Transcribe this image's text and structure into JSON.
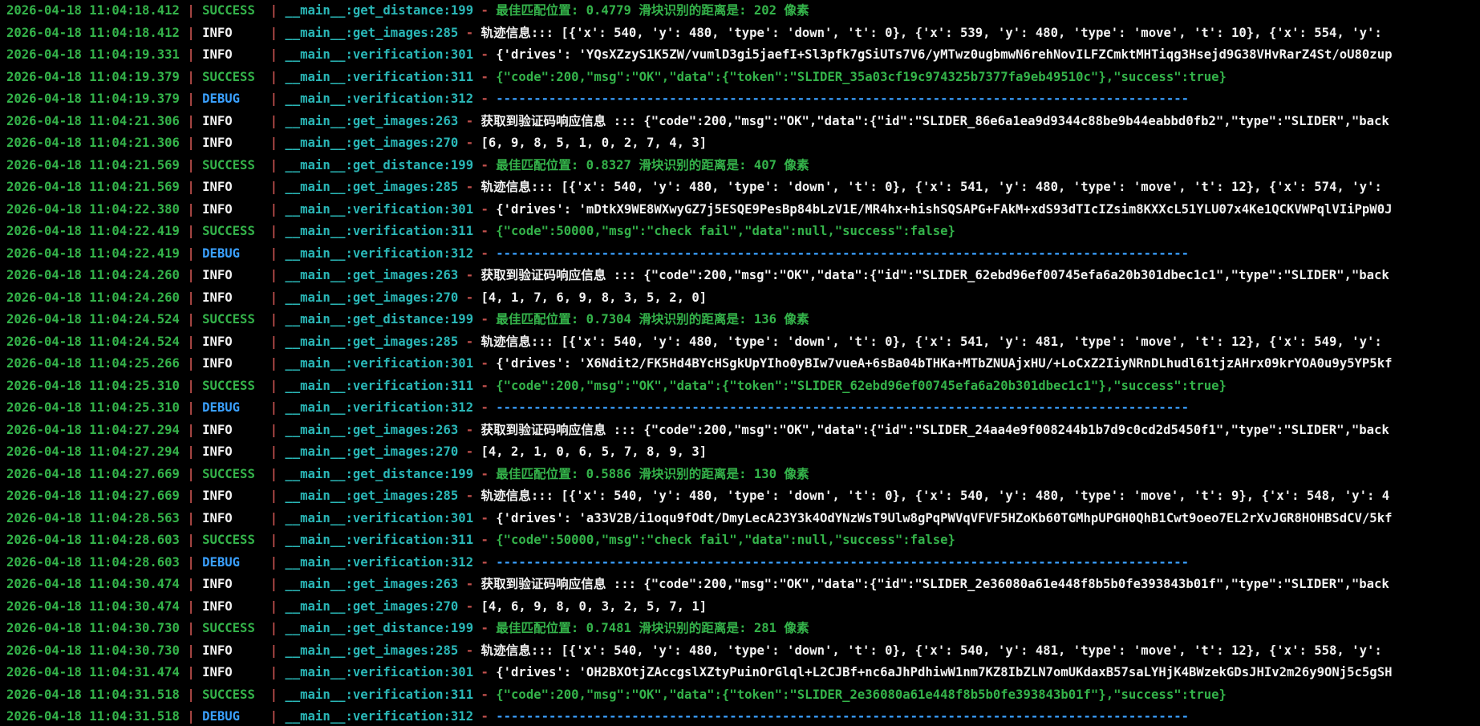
{
  "colors": {
    "background": "#000000",
    "timestamp": "#34b34a",
    "separator": "#c0504d",
    "info": "#f2f2f2",
    "success": "#34b34a",
    "debug": "#3aa0ff",
    "module": "#2ab7b7"
  },
  "log_lines": [
    {
      "time": "2026-04-18 11:04:18.412",
      "level": "SUCCESS",
      "location": "__main__:get_distance:199",
      "message": "最佳匹配位置: 0.4779 滑块识别的距离是: 202 像素"
    },
    {
      "time": "2026-04-18 11:04:18.412",
      "level": "INFO",
      "location": "__main__:get_images:285",
      "message": "轨迹信息::: [{'x': 540, 'y': 480, 'type': 'down', 't': 0}, {'x': 539, 'y': 480, 'type': 'move', 't': 10}, {'x': 554, 'y':"
    },
    {
      "time": "2026-04-18 11:04:19.331",
      "level": "INFO",
      "location": "__main__:verification:301",
      "message": "{'drives': 'YQsXZzyS1K5ZW/vumlD3gi5jaefI+Sl3pfk7gSiUTs7V6/yMTwz0ugbmwN6rehNovILFZCmktMHTiqg3Hsejd9G38VHvRarZ4St/oU80zup"
    },
    {
      "time": "2026-04-18 11:04:19.379",
      "level": "SUCCESS",
      "location": "__main__:verification:311",
      "message": "{\"code\":200,\"msg\":\"OK\",\"data\":{\"token\":\"SLIDER_35a03cf19c974325b7377fa9eb49510c\"},\"success\":true}"
    },
    {
      "time": "2026-04-18 11:04:19.379",
      "level": "DEBUG",
      "location": "__main__:verification:312",
      "message": "--------------------------------------------------------------------------------------------"
    },
    {
      "time": "2026-04-18 11:04:21.306",
      "level": "INFO",
      "location": "__main__:get_images:263",
      "message": "获取到验证码响应信息 ::: {\"code\":200,\"msg\":\"OK\",\"data\":{\"id\":\"SLIDER_86e6a1ea9d9344c88be9b44eabbd0fb2\",\"type\":\"SLIDER\",\"back"
    },
    {
      "time": "2026-04-18 11:04:21.306",
      "level": "INFO",
      "location": "__main__:get_images:270",
      "message": "[6, 9, 8, 5, 1, 0, 2, 7, 4, 3]"
    },
    {
      "time": "2026-04-18 11:04:21.569",
      "level": "SUCCESS",
      "location": "__main__:get_distance:199",
      "message": "最佳匹配位置: 0.8327 滑块识别的距离是: 407 像素"
    },
    {
      "time": "2026-04-18 11:04:21.569",
      "level": "INFO",
      "location": "__main__:get_images:285",
      "message": "轨迹信息::: [{'x': 540, 'y': 480, 'type': 'down', 't': 0}, {'x': 541, 'y': 480, 'type': 'move', 't': 12}, {'x': 574, 'y':"
    },
    {
      "time": "2026-04-18 11:04:22.380",
      "level": "INFO",
      "location": "__main__:verification:301",
      "message": "{'drives': 'mDtkX9WE8WXwyGZ7j5ESQE9PesBp84bLzV1E/MR4hx+hishSQSAPG+FAkM+xdS93dTIcIZsim8KXXcL51YLU07x4Ke1QCKVWPqlVIiPpW0J"
    },
    {
      "time": "2026-04-18 11:04:22.419",
      "level": "SUCCESS",
      "location": "__main__:verification:311",
      "message": "{\"code\":50000,\"msg\":\"check fail\",\"data\":null,\"success\":false}"
    },
    {
      "time": "2026-04-18 11:04:22.419",
      "level": "DEBUG",
      "location": "__main__:verification:312",
      "message": "--------------------------------------------------------------------------------------------"
    },
    {
      "time": "2026-04-18 11:04:24.260",
      "level": "INFO",
      "location": "__main__:get_images:263",
      "message": "获取到验证码响应信息 ::: {\"code\":200,\"msg\":\"OK\",\"data\":{\"id\":\"SLIDER_62ebd96ef00745efa6a20b301dbec1c1\",\"type\":\"SLIDER\",\"back"
    },
    {
      "time": "2026-04-18 11:04:24.260",
      "level": "INFO",
      "location": "__main__:get_images:270",
      "message": "[4, 1, 7, 6, 9, 8, 3, 5, 2, 0]"
    },
    {
      "time": "2026-04-18 11:04:24.524",
      "level": "SUCCESS",
      "location": "__main__:get_distance:199",
      "message": "最佳匹配位置: 0.7304 滑块识别的距离是: 136 像素"
    },
    {
      "time": "2026-04-18 11:04:24.524",
      "level": "INFO",
      "location": "__main__:get_images:285",
      "message": "轨迹信息::: [{'x': 540, 'y': 480, 'type': 'down', 't': 0}, {'x': 541, 'y': 481, 'type': 'move', 't': 12}, {'x': 549, 'y':"
    },
    {
      "time": "2026-04-18 11:04:25.266",
      "level": "INFO",
      "location": "__main__:verification:301",
      "message": "{'drives': 'X6Ndit2/FK5Hd4BYcHSgkUpYIho0yBIw7vueA+6sBa04bTHKa+MTbZNUAjxHU/+LoCxZ2IiyNRnDLhudl61tjzAHrx09krYOA0u9y5YP5kf"
    },
    {
      "time": "2026-04-18 11:04:25.310",
      "level": "SUCCESS",
      "location": "__main__:verification:311",
      "message": "{\"code\":200,\"msg\":\"OK\",\"data\":{\"token\":\"SLIDER_62ebd96ef00745efa6a20b301dbec1c1\"},\"success\":true}"
    },
    {
      "time": "2026-04-18 11:04:25.310",
      "level": "DEBUG",
      "location": "__main__:verification:312",
      "message": "--------------------------------------------------------------------------------------------"
    },
    {
      "time": "2026-04-18 11:04:27.294",
      "level": "INFO",
      "location": "__main__:get_images:263",
      "message": "获取到验证码响应信息 ::: {\"code\":200,\"msg\":\"OK\",\"data\":{\"id\":\"SLIDER_24aa4e9f008244b1b7d9c0cd2d5450f1\",\"type\":\"SLIDER\",\"back"
    },
    {
      "time": "2026-04-18 11:04:27.294",
      "level": "INFO",
      "location": "__main__:get_images:270",
      "message": "[4, 2, 1, 0, 6, 5, 7, 8, 9, 3]"
    },
    {
      "time": "2026-04-18 11:04:27.669",
      "level": "SUCCESS",
      "location": "__main__:get_distance:199",
      "message": "最佳匹配位置: 0.5886 滑块识别的距离是: 130 像素"
    },
    {
      "time": "2026-04-18 11:04:27.669",
      "level": "INFO",
      "location": "__main__:get_images:285",
      "message": "轨迹信息::: [{'x': 540, 'y': 480, 'type': 'down', 't': 0}, {'x': 540, 'y': 480, 'type': 'move', 't': 9}, {'x': 548, 'y': 4"
    },
    {
      "time": "2026-04-18 11:04:28.563",
      "level": "INFO",
      "location": "__main__:verification:301",
      "message": "{'drives': 'a33V2B/i1oqu9fOdt/DmyLecA23Y3k4OdYNzWsT9Ulw8gPqPWVqVFVF5HZoKb60TGMhpUPGH0QhB1Cwt9oeo7EL2rXvJGR8HOHBSdCV/5kf"
    },
    {
      "time": "2026-04-18 11:04:28.603",
      "level": "SUCCESS",
      "location": "__main__:verification:311",
      "message": "{\"code\":50000,\"msg\":\"check fail\",\"data\":null,\"success\":false}"
    },
    {
      "time": "2026-04-18 11:04:28.603",
      "level": "DEBUG",
      "location": "__main__:verification:312",
      "message": "--------------------------------------------------------------------------------------------"
    },
    {
      "time": "2026-04-18 11:04:30.474",
      "level": "INFO",
      "location": "__main__:get_images:263",
      "message": "获取到验证码响应信息 ::: {\"code\":200,\"msg\":\"OK\",\"data\":{\"id\":\"SLIDER_2e36080a61e448f8b5b0fe393843b01f\",\"type\":\"SLIDER\",\"back"
    },
    {
      "time": "2026-04-18 11:04:30.474",
      "level": "INFO",
      "location": "__main__:get_images:270",
      "message": "[4, 6, 9, 8, 0, 3, 2, 5, 7, 1]"
    },
    {
      "time": "2026-04-18 11:04:30.730",
      "level": "SUCCESS",
      "location": "__main__:get_distance:199",
      "message": "最佳匹配位置: 0.7481 滑块识别的距离是: 281 像素"
    },
    {
      "time": "2026-04-18 11:04:30.730",
      "level": "INFO",
      "location": "__main__:get_images:285",
      "message": "轨迹信息::: [{'x': 540, 'y': 480, 'type': 'down', 't': 0}, {'x': 540, 'y': 481, 'type': 'move', 't': 12}, {'x': 558, 'y':"
    },
    {
      "time": "2026-04-18 11:04:31.474",
      "level": "INFO",
      "location": "__main__:verification:301",
      "message": "{'drives': 'OH2BXOtjZAccgslXZtyPuinOrGlql+L2CJBf+nc6aJhPdhiwW1nm7KZ8IbZLN7omUKdaxB57saLYHjK4BWzekGDsJHIv2m26y9ONj5c5gSH"
    },
    {
      "time": "2026-04-18 11:04:31.518",
      "level": "SUCCESS",
      "location": "__main__:verification:311",
      "message": "{\"code\":200,\"msg\":\"OK\",\"data\":{\"token\":\"SLIDER_2e36080a61e448f8b5b0fe393843b01f\"},\"success\":true}"
    },
    {
      "time": "2026-04-18 11:04:31.518",
      "level": "DEBUG",
      "location": "__main__:verification:312",
      "message": "--------------------------------------------------------------------------------------------"
    }
  ]
}
